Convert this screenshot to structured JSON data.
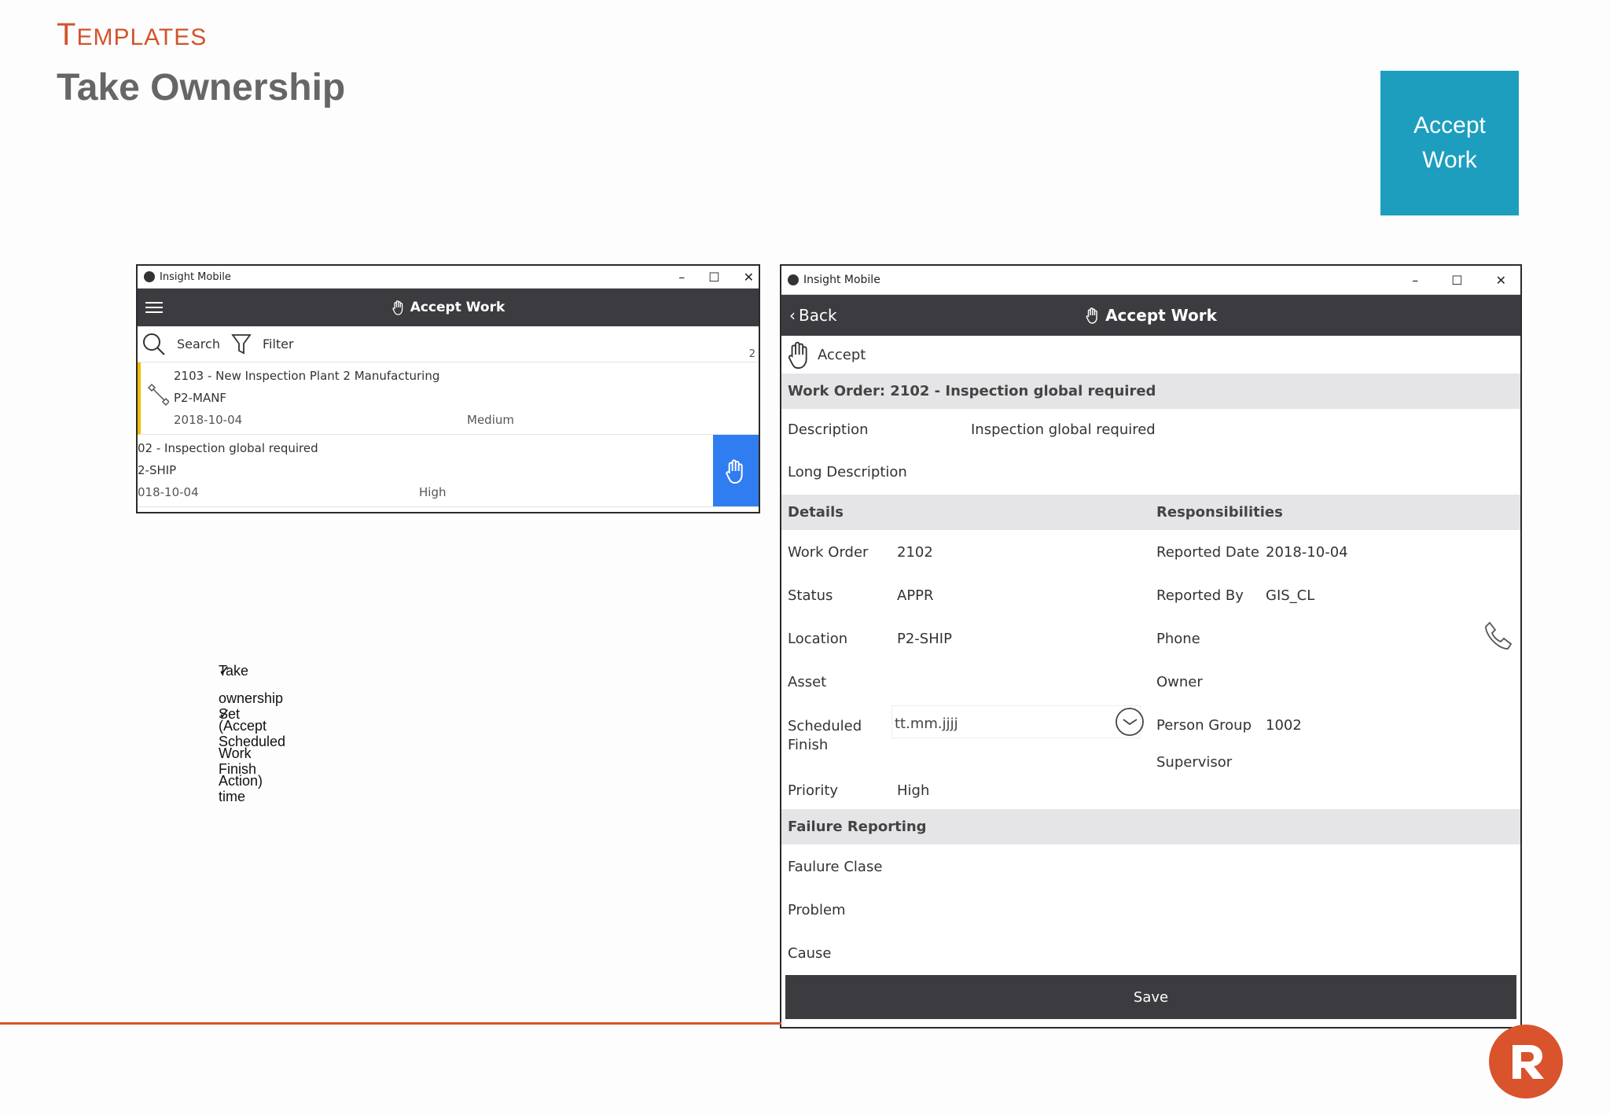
{
  "slide": {
    "section_label_first": "T",
    "section_label_rest": "EMPLATES",
    "title": "Take Ownership",
    "tile_line1": "Accept",
    "tile_line2": "Work",
    "bullets": [
      "Take ownership (Accept Work Action)",
      "Set Scheduled Finish time"
    ],
    "check_glyph": "✓",
    "accent_color": "#d2542d",
    "tile_color": "#1d9ebf"
  },
  "list_window": {
    "app_name": "Insight Mobile",
    "header_title": "Accept Work",
    "search_label": "Search",
    "filter_label": "Filter",
    "count": "2",
    "items": [
      {
        "title": "2103 - New Inspection Plant 2 Manufacturing",
        "location": "P2-MANF",
        "date": "2018-10-04",
        "priority": "Medium"
      },
      {
        "title": "02 - Inspection global required",
        "location": "2-SHIP",
        "date": "018-10-04",
        "priority": "High"
      }
    ]
  },
  "detail_window": {
    "app_name": "Insight Mobile",
    "back_label": "Back",
    "header_title": "Accept Work",
    "accept_label": "Accept",
    "work_order_band": "Work Order: 2102 - Inspection global required",
    "description_label": "Description",
    "description_value": "Inspection global required",
    "long_description_label": "Long Description",
    "details_band": "Details",
    "responsibilities_band": "Responsibilities",
    "work_order_label": "Work Order",
    "work_order_value": "2102",
    "status_label": "Status",
    "status_value": "APPR",
    "location_label": "Location",
    "location_value": "P2-SHIP",
    "asset_label": "Asset",
    "scheduled_finish_label1": "Scheduled",
    "scheduled_finish_label2": "Finish",
    "scheduled_finish_placeholder": "tt.mm.jjjj",
    "priority_label": "Priority",
    "priority_value": "High",
    "reported_date_label": "Reported Date",
    "reported_date_value": "2018-10-04",
    "reported_by_label": "Reported By",
    "reported_by_value": "GIS_CL",
    "phone_label": "Phone",
    "owner_label": "Owner",
    "person_group_label": "Person Group",
    "person_group_value": "1002",
    "supervisor_label": "Supervisor",
    "failure_band": "Failure Reporting",
    "failure_class_label": "Faulure Clase",
    "problem_label": "Problem",
    "cause_label": "Cause",
    "save_label": "Save"
  }
}
